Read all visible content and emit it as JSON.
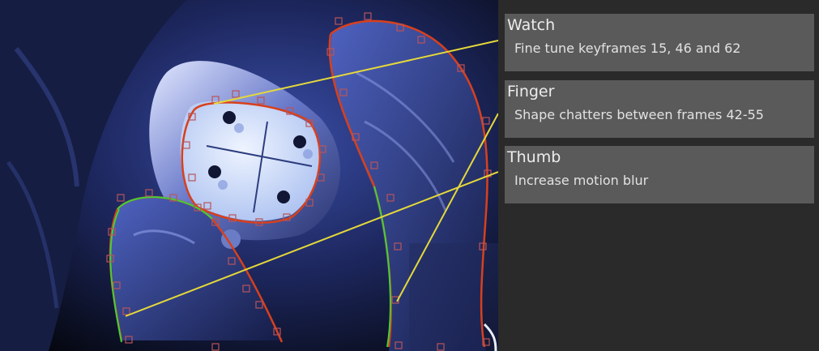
{
  "notes": [
    {
      "title": "Watch",
      "body": "Fine tune keyframes 15, 46 and 62"
    },
    {
      "title": "Finger",
      "body": "Shape chatters between frames 42-55"
    },
    {
      "title": "Thumb",
      "body": "Increase motion blur"
    }
  ],
  "colors": {
    "panel_bg": "#2a2a2a",
    "note_bg": "#5a5a5a",
    "leader_line": "#e5d93a",
    "roto_shape_red": "#d8401c",
    "roto_shape_green": "#3fd23a",
    "roto_point": "#b8545a"
  }
}
